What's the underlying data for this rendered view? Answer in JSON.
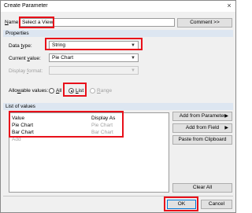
{
  "window": {
    "title": "Create Parameter",
    "close_icon": "×"
  },
  "name": {
    "label": "Name:",
    "value": "Select a View"
  },
  "comment_button": "Comment >>",
  "properties": {
    "header": "Properties",
    "data_type_label": "Data type:",
    "data_type_value": "String",
    "current_value_label": "Current value:",
    "current_value_value": "Pie Chart",
    "display_format_label": "Display format:",
    "display_format_value": "",
    "allowable_label": "Allowable values:",
    "options": {
      "all": "All",
      "list": "List",
      "range": "Range"
    },
    "selected": "List"
  },
  "list_of_values": {
    "header": "List of values",
    "columns": {
      "value": "Value",
      "display_as": "Display As"
    },
    "rows": [
      {
        "value": "Pie Chart",
        "display_as": "Pie Chart"
      },
      {
        "value": "Bar Chart",
        "display_as": "Bar Chart"
      }
    ],
    "add_placeholder": "Add"
  },
  "side_buttons": {
    "add_from_parameter": "Add from Parameter",
    "add_from_field": "Add from Field",
    "paste_from_clipboard": "Paste from Clipboard",
    "clear_all": "Clear All"
  },
  "footer": {
    "ok": "OK",
    "cancel": "Cancel"
  },
  "colors": {
    "highlight": "#e8101a",
    "header_bg": "#dde6f1"
  }
}
